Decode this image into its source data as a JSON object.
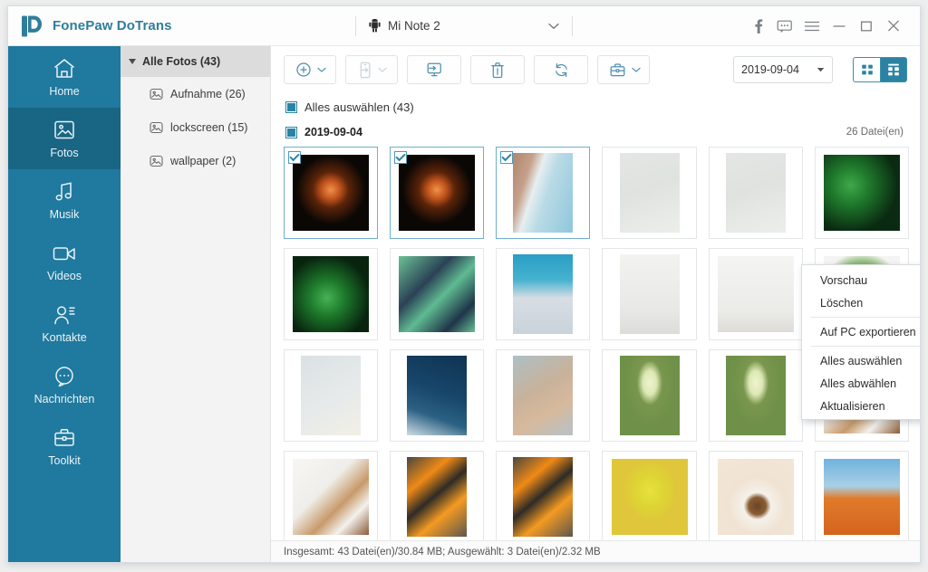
{
  "window": {
    "app_title": "FonePaw DoTrans",
    "logo_icon": "fonepaw-logo-icon",
    "device": {
      "icon": "android-robot-icon",
      "name": "Mi Note 2",
      "caret_icon": "chevron-down-icon"
    },
    "controls": [
      {
        "name": "facebook-button",
        "icon": "facebook-f-icon"
      },
      {
        "name": "feedback-button",
        "icon": "comment-bubble-icon"
      },
      {
        "name": "menu-button",
        "icon": "hamburger-menu-icon"
      },
      {
        "name": "minimize-button",
        "icon": "minimize-icon"
      },
      {
        "name": "maximize-button",
        "icon": "maximize-square-icon"
      },
      {
        "name": "close-button",
        "icon": "close-x-icon"
      }
    ]
  },
  "sidebar": {
    "items": [
      {
        "label": "Home",
        "icon": "home-icon",
        "selected": false
      },
      {
        "label": "Fotos",
        "icon": "photo-icon",
        "selected": true
      },
      {
        "label": "Musik",
        "icon": "music-icon",
        "selected": false
      },
      {
        "label": "Videos",
        "icon": "video-icon",
        "selected": false
      },
      {
        "label": "Kontakte",
        "icon": "contact-icon",
        "selected": false
      },
      {
        "label": "Nachrichten",
        "icon": "message-icon",
        "selected": false
      },
      {
        "label": "Toolkit",
        "icon": "toolkit-icon",
        "selected": false
      }
    ]
  },
  "tree": {
    "header": {
      "label": "Alle Fotos (43)",
      "expand_icon": "triangle-down-icon"
    },
    "items": [
      {
        "label": "Aufnahme (26)",
        "icon": "album-image-icon"
      },
      {
        "label": "lockscreen (15)",
        "icon": "album-image-icon"
      },
      {
        "label": "wallpaper (2)",
        "icon": "album-image-icon"
      }
    ]
  },
  "toolbar": {
    "buttons": [
      {
        "name": "add-button",
        "icon": "plus-circle-icon",
        "caret": true,
        "disabled": false
      },
      {
        "name": "export-to-phone",
        "icon": "phone-import-icon",
        "caret": true,
        "disabled": true
      },
      {
        "name": "export-to-pc-button",
        "icon": "monitor-export-icon",
        "caret": false,
        "disabled": false
      },
      {
        "name": "delete-button",
        "icon": "trash-icon",
        "caret": false,
        "disabled": false
      },
      {
        "name": "refresh-button",
        "icon": "refresh-icon",
        "caret": false,
        "disabled": false
      },
      {
        "name": "toolkit-button",
        "icon": "briefcase-icon",
        "caret": true,
        "disabled": false
      }
    ],
    "date_filter": {
      "value": "2019-09-04",
      "caret_icon": "caret-down-icon"
    },
    "views": [
      {
        "name": "view-grid-small",
        "icon": "grid-view-icon",
        "active": false
      },
      {
        "name": "view-grid-group",
        "icon": "group-view-icon",
        "active": true
      }
    ]
  },
  "main": {
    "select_all_label": "Alles auswählen (43)",
    "group": {
      "date": "2019-09-04",
      "file_count": "26 Datei(en)"
    }
  },
  "context_menu": {
    "items": [
      {
        "label": "Vorschau",
        "sep_after": false
      },
      {
        "label": "Löschen",
        "sep_after": true
      },
      {
        "label": "Auf PC exportieren",
        "sep_after": true
      },
      {
        "label": "Alles auswählen",
        "sep_after": false
      },
      {
        "label": "Alles abwählen",
        "sep_after": false
      },
      {
        "label": "Aktualisieren",
        "sep_after": false
      }
    ]
  },
  "status": {
    "text": "Insgesamt: 43 Datei(en)/30.84 MB; Ausgewählt: 3 Datei(en)/2.32 MB"
  },
  "colors": {
    "brand_teal": "#20799e",
    "brand_teal_dark": "#186684",
    "accent": "#2b83a4",
    "selection_border": "#6fafce"
  },
  "thumbnails": [
    {
      "id": "t1",
      "alt": "orange firework on black",
      "selected": true,
      "tall": false,
      "style": "radial-gradient(circle at 50% 46%, #f0924a 0%, #c4561e 16%, #5c2409 32%, #0a0705 62%), #050505"
    },
    {
      "id": "t2",
      "alt": "orange firework on black",
      "selected": true,
      "tall": false,
      "style": "radial-gradient(circle at 50% 46%, #f0924a 0%, #c4561e 16%, #5c2409 32%, #0a0705 62%), #050505"
    },
    {
      "id": "t3",
      "alt": "aerial beach shoreline",
      "selected": true,
      "tall": true,
      "style": "linear-gradient(108deg, #b08670 0%, #c5a08a 24%, #e8eef0 38%, #b9dbe6 55%, #8fc6dc 100%)"
    },
    {
      "id": "t4",
      "alt": "white orchid flower",
      "selected": false,
      "tall": true,
      "style": "linear-gradient(160deg, #e4e6e4 0%, #dfe3e0 45%, #eceee9 100%)"
    },
    {
      "id": "t5",
      "alt": "white orchid flower",
      "selected": false,
      "tall": true,
      "style": "linear-gradient(160deg, #e4e6e4 0%, #dfe3e0 45%, #eceee9 100%)"
    },
    {
      "id": "t6",
      "alt": "green ferns dark",
      "selected": false,
      "tall": false,
      "style": "radial-gradient(circle at 35% 40%, #3fa84a 0%, #1f7a2c 28%, #0a2a11 70%), #07180c"
    },
    {
      "id": "t7",
      "alt": "green ferns dark",
      "selected": false,
      "tall": false,
      "style": "radial-gradient(circle at 45% 55%, #46b253 0%, #1d7a2b 30%, #08240f 72%), #061509"
    },
    {
      "id": "t8",
      "alt": "abstract teal geometry",
      "selected": false,
      "tall": false,
      "style": "linear-gradient(135deg, #6cc195 0%, #2a4256 35%, #5fbb92 55%, #1f3549 80%, #68bf93 100%)"
    },
    {
      "id": "t9",
      "alt": "blue water and snow",
      "selected": false,
      "tall": true,
      "style": "linear-gradient(180deg, #2b9ec4 0%, #45b2cf 32%, #d8dde4 55%, #c9d2da 100%)"
    },
    {
      "id": "t10",
      "alt": "white flower in vase",
      "selected": false,
      "tall": true,
      "style": "linear-gradient(180deg, #f2f2f0 0%, #e8e8e6 70%, #dcdcd9 100%)"
    },
    {
      "id": "t11",
      "alt": "eucalyptus sprig in vase",
      "selected": false,
      "tall": false,
      "style": "linear-gradient(180deg, #f4f4f2 0%, #ebebe8 72%, #dedcd8 100%)"
    },
    {
      "id": "t12",
      "alt": "green wreath on white",
      "selected": false,
      "tall": false,
      "style": "radial-gradient(ellipse at 50% 50%, #f6f6f4 0%, #f6f6f4 34%, #6fa35c 48%, #8fbc7a 60%, #f4f4f2 78%)"
    },
    {
      "id": "t13",
      "alt": "pale grey water droplets",
      "selected": false,
      "tall": true,
      "style": "linear-gradient(150deg, #dbe1e3 0%, #e6eaea 55%, #f2efe6 100%)"
    },
    {
      "id": "t14",
      "alt": "dark blue ocean wave",
      "selected": false,
      "tall": true,
      "style": "linear-gradient(200deg, #0f3352 0%, #17466b 45%, #2b6183 72%, #cfdde4 100%)"
    },
    {
      "id": "t15",
      "alt": "cherry blossom branches",
      "selected": false,
      "tall": true,
      "style": "linear-gradient(150deg, #aebfc6 0%, #c8b29a 42%, #d7b99c 68%, #b6c3c8 100%)"
    },
    {
      "id": "t16",
      "alt": "white carnation on green",
      "selected": false,
      "tall": true,
      "style": "radial-gradient(ellipse at 50% 34%, #eef3cf 0%, #dde8b4 16%, #79964e 30%, #6f9049 60%), #6f9049"
    },
    {
      "id": "t17",
      "alt": "white carnation on green",
      "selected": false,
      "tall": true,
      "style": "radial-gradient(ellipse at 50% 34%, #eef3cf 0%, #dde8b4 16%, #79964e 30%, #6f9049 60%), #6f9049"
    },
    {
      "id": "t18",
      "alt": "acorns and autumn leaves",
      "selected": false,
      "tall": false,
      "style": "linear-gradient(135deg, #f7f6f3 0%, #efeeea 40%, #c79a6a 62%, #f3f1ec 78%, #8a5a36 100%)"
    },
    {
      "id": "t19",
      "alt": "acorns and autumn leaves",
      "selected": false,
      "tall": false,
      "style": "linear-gradient(135deg, #f7f6f3 0%, #efeeea 40%, #c79a6a 62%, #f3f1ec 78%, #8a5a36 100%)"
    },
    {
      "id": "t20",
      "alt": "orange autumn leaves",
      "selected": false,
      "tall": true,
      "style": "linear-gradient(140deg, #4a4640 0%, #f08a16 28%, #2e2b26 48%, #f49a22 68%, #5c564e 100%)"
    },
    {
      "id": "t21",
      "alt": "orange autumn leaves",
      "selected": false,
      "tall": true,
      "style": "linear-gradient(140deg, #4a4640 0%, #f08a16 28%, #2e2b26 48%, #f49a22 68%, #5c564e 100%)"
    },
    {
      "id": "t22",
      "alt": "yellow balloons on yellow",
      "selected": false,
      "tall": false,
      "style": "radial-gradient(ellipse at 50% 42%, #e8e23c 0%, #ddd534 26%, #e0c63a 50%), #e0c63a"
    },
    {
      "id": "t23",
      "alt": "coffee cup top view",
      "selected": false,
      "tall": false,
      "style": "radial-gradient(circle at 52% 62%, #6b4526 0%, #8a5c33 14%, #f5f1ea 22%, #f0e3d3 46%, #f3e6d6 100%)"
    },
    {
      "id": "t24",
      "alt": "orange desert sand dune",
      "selected": false,
      "tall": false,
      "style": "linear-gradient(180deg, #6fb3dd 0%, #a9cfe4 36%, #e07b2a 52%, #d4641d 100%)"
    }
  ]
}
